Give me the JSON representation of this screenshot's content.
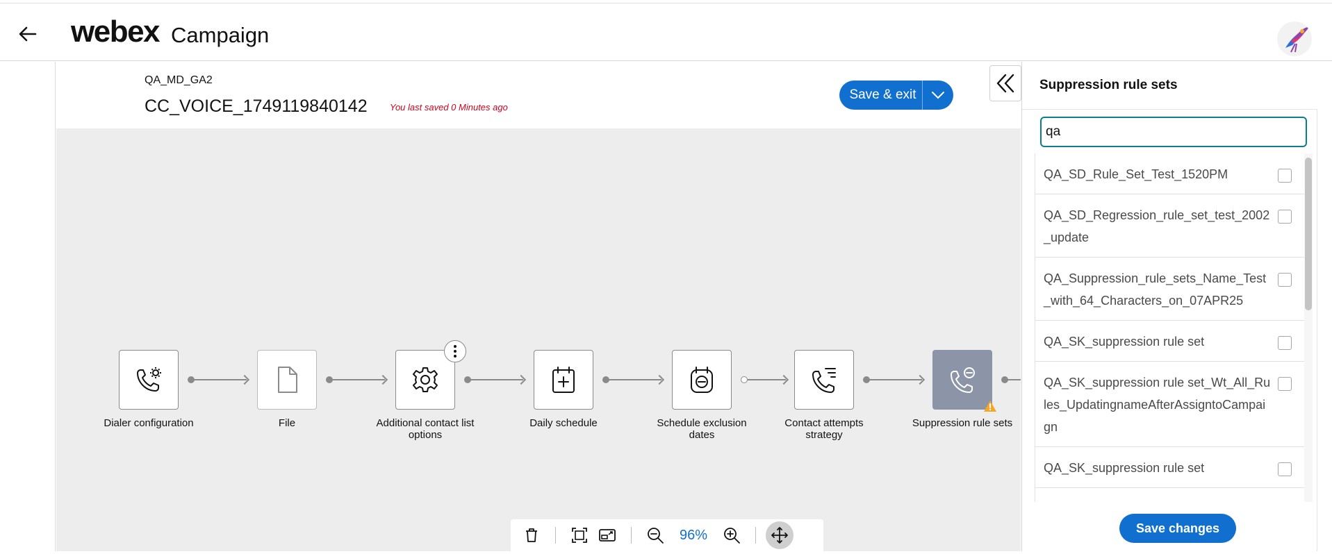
{
  "header": {
    "brand": "webex",
    "product": "Campaign"
  },
  "campaign": {
    "parent": "QA_MD_GA2",
    "name": "CC_VOICE_1749119840142",
    "last_saved": "You last saved 0 Minutes ago",
    "save_exit_label": "Save & exit"
  },
  "flow": {
    "nodes": [
      {
        "label": "Dialer configuration",
        "icon": "phone-gear-icon"
      },
      {
        "label": "File",
        "icon": "file-icon"
      },
      {
        "label": "Additional contact list options",
        "icon": "gear-icon"
      },
      {
        "label": "Daily schedule",
        "icon": "calendar-plus-icon"
      },
      {
        "label": "Schedule exclusion dates",
        "icon": "calendar-minus-icon"
      },
      {
        "label": "Contact attempts strategy",
        "icon": "phone-list-icon"
      },
      {
        "label": "Suppression rule sets",
        "icon": "phone-minus-icon"
      }
    ]
  },
  "toolbar": {
    "zoom": "96%"
  },
  "panel": {
    "title": "Suppression rule sets",
    "search_value": "qa",
    "items": [
      {
        "label": "QA_SD_Rule_Set_Test_1520PM",
        "checked": false
      },
      {
        "label": "QA_SD_Regression_rule_set_test_2002_update",
        "checked": false
      },
      {
        "label": "QA_Suppression_rule_sets_Name_Test_with_64_Characters_on_07APR25",
        "checked": false
      },
      {
        "label": "QA_SK_suppression rule set",
        "checked": false
      },
      {
        "label": "QA_SK_suppression rule set_Wt_All_Rules_UpdatingnameAfterAssigntoCampaign",
        "checked": false
      },
      {
        "label": "QA_SK_suppression rule set",
        "checked": false
      }
    ],
    "save_label": "Save changes"
  },
  "colors": {
    "primary": "#1170cf",
    "canvas": "#ededed",
    "active_node": "#8b95a7",
    "warning": "#f5a623",
    "error_text": "#d0021b"
  }
}
